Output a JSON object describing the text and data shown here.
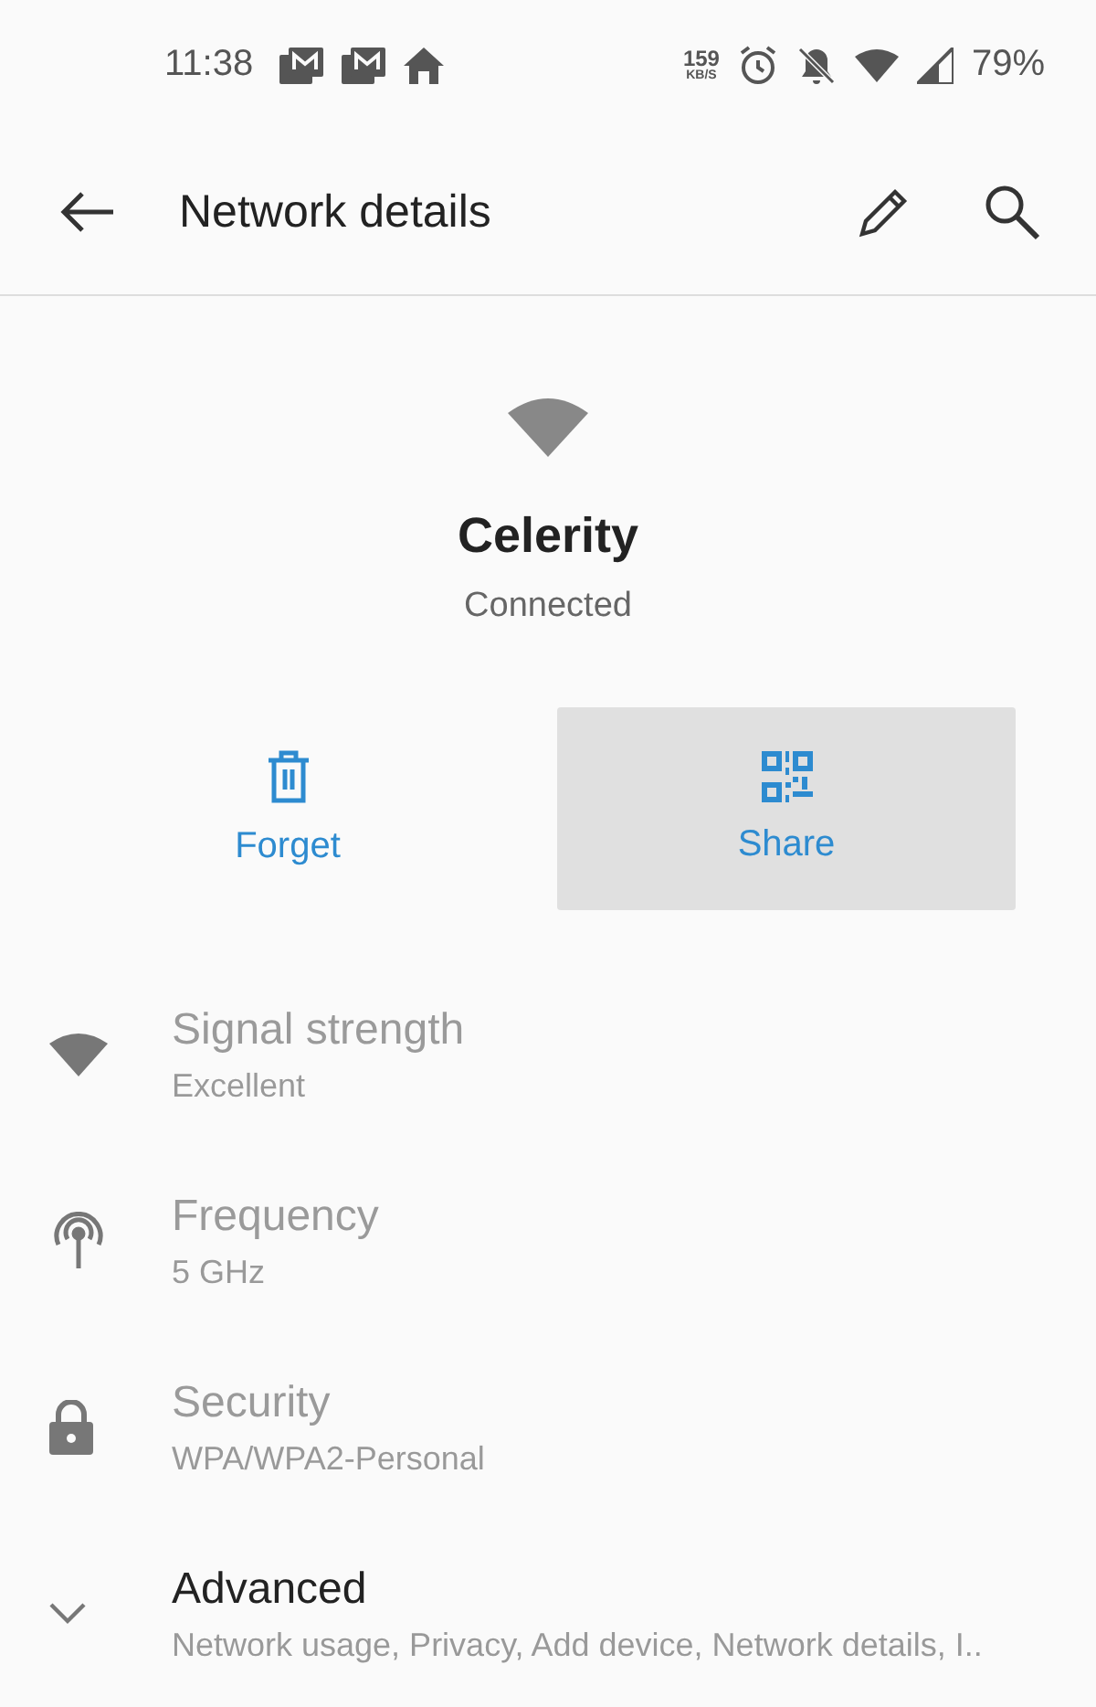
{
  "status_bar": {
    "time": "11:38",
    "speed_value": "159",
    "speed_unit": "KB/S",
    "battery": "79%"
  },
  "toolbar": {
    "title": "Network details"
  },
  "network": {
    "name": "Celerity",
    "status": "Connected"
  },
  "actions": [
    {
      "kind": "forget",
      "label": "Forget",
      "selected": false
    },
    {
      "kind": "share",
      "label": "Share",
      "selected": true
    }
  ],
  "details": [
    {
      "kind": "signal",
      "title": "Signal strength",
      "value": "Excellent",
      "disabled": true
    },
    {
      "kind": "frequency",
      "title": "Frequency",
      "value": "5 GHz",
      "disabled": true
    },
    {
      "kind": "security",
      "title": "Security",
      "value": "WPA/WPA2-Personal",
      "disabled": true
    },
    {
      "kind": "advanced",
      "title": "Advanced",
      "value": "Network usage, Privacy, Add device, Network details, I..",
      "disabled": false
    }
  ]
}
